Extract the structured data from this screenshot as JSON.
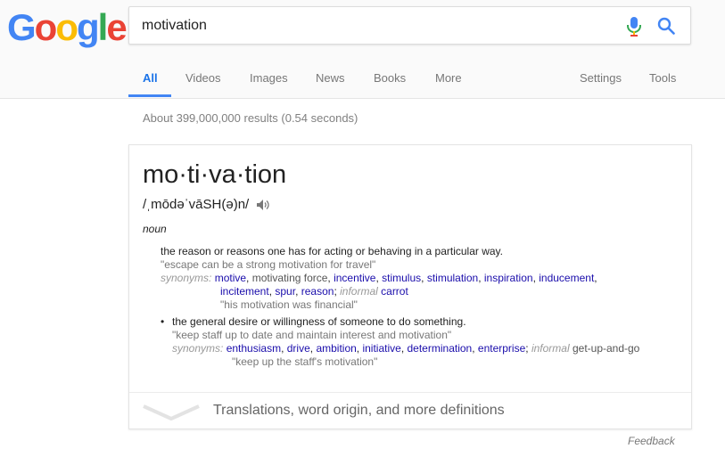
{
  "logo": {
    "letters": [
      "G",
      "o",
      "o",
      "g",
      "l",
      "e"
    ],
    "colors": [
      "#4285F4",
      "#EA4335",
      "#FBBC05",
      "#4285F4",
      "#34A853",
      "#EA4335"
    ]
  },
  "search": {
    "query": "motivation"
  },
  "tabs": [
    {
      "label": "All",
      "active": true
    },
    {
      "label": "Videos"
    },
    {
      "label": "Images"
    },
    {
      "label": "News"
    },
    {
      "label": "Books"
    },
    {
      "label": "More"
    },
    {
      "label": "Settings"
    },
    {
      "label": "Tools"
    }
  ],
  "result_stats": "About 399,000,000 results (0.54 seconds)",
  "card": {
    "headword": "mo·ti·va·tion",
    "pronunciation": "/ˌmōdəˈvāSH(ə)n/",
    "part_of_speech": "noun",
    "senses": [
      {
        "definition": "the reason or reasons one has for acting or behaving in a particular way.",
        "example": "\"escape can be a strong motivation for travel\"",
        "synonyms_label": "synonyms:",
        "syn_line1": [
          "motive",
          ", ",
          "motivating force",
          ", ",
          "incentive",
          ", ",
          "stimulus",
          ", ",
          "stimulation",
          ", ",
          "inspiration",
          ", ",
          "inducement",
          ","
        ],
        "syn_line2": [
          "incitement",
          ", ",
          "spur",
          ", ",
          "reason",
          "; ",
          "informal",
          " ",
          "carrot"
        ],
        "syn_example": "\"his motivation was financial\""
      },
      {
        "bullet": "•",
        "definition": "the general desire or willingness of someone to do something.",
        "example": "\"keep staff up to date and maintain interest and motivation\"",
        "synonyms_label": "synonyms:",
        "syn_line1": [
          "enthusiasm",
          ", ",
          "drive",
          ", ",
          "ambition",
          ", ",
          "initiative",
          ", ",
          "determination",
          ", ",
          "enterprise",
          "; ",
          "informal",
          " ",
          "get-up-and-go"
        ],
        "syn_example": "\"keep up the staff's motivation\""
      }
    ],
    "more_text": "Translations, word origin, and more definitions"
  },
  "feedback": "Feedback"
}
